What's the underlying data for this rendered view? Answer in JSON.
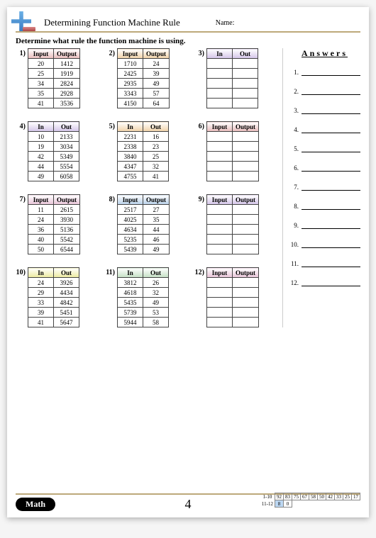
{
  "header": {
    "title": "Determining Function Machine Rule",
    "name_label": "Name:"
  },
  "instruction": "Determine what rule the function machine is using.",
  "answers_heading": "Answers",
  "answer_count": 12,
  "footer": {
    "math_label": "Math",
    "page_number": "4",
    "score_rows": [
      {
        "lbl": "1-10",
        "cells": [
          "92",
          "83",
          "75",
          "67",
          "58",
          "50",
          "42",
          "33",
          "25",
          "17"
        ]
      },
      {
        "lbl": "11-12",
        "cells": [
          "8",
          "0"
        ]
      }
    ]
  },
  "problems": [
    {
      "n": "1)",
      "head": [
        "Input",
        "Output"
      ],
      "grad": "g-red",
      "rows": [
        [
          "20",
          "1412"
        ],
        [
          "25",
          "1919"
        ],
        [
          "34",
          "2824"
        ],
        [
          "35",
          "2928"
        ],
        [
          "41",
          "3536"
        ]
      ]
    },
    {
      "n": "2)",
      "head": [
        "Input",
        "Output"
      ],
      "grad": "g-orange",
      "rows": [
        [
          "1710",
          "24"
        ],
        [
          "2425",
          "39"
        ],
        [
          "2935",
          "49"
        ],
        [
          "3343",
          "57"
        ],
        [
          "4150",
          "64"
        ]
      ]
    },
    {
      "n": "3)",
      "head": [
        "In",
        "Out"
      ],
      "grad": "g-purple",
      "rows": [
        [
          "",
          ""
        ],
        [
          "",
          ""
        ],
        [
          "",
          ""
        ],
        [
          "",
          ""
        ],
        [
          "",
          ""
        ]
      ]
    },
    {
      "n": "4)",
      "head": [
        "In",
        "Out"
      ],
      "grad": "g-purple",
      "rows": [
        [
          "10",
          "2133"
        ],
        [
          "19",
          "3034"
        ],
        [
          "42",
          "5349"
        ],
        [
          "44",
          "5554"
        ],
        [
          "49",
          "6058"
        ]
      ]
    },
    {
      "n": "5)",
      "head": [
        "In",
        "Out"
      ],
      "grad": "g-orange",
      "rows": [
        [
          "2231",
          "16"
        ],
        [
          "2338",
          "23"
        ],
        [
          "3840",
          "25"
        ],
        [
          "4347",
          "32"
        ],
        [
          "4755",
          "41"
        ]
      ]
    },
    {
      "n": "6)",
      "head": [
        "Input",
        "Output"
      ],
      "grad": "g-red",
      "rows": [
        [
          "",
          ""
        ],
        [
          "",
          ""
        ],
        [
          "",
          ""
        ],
        [
          "",
          ""
        ],
        [
          "",
          ""
        ]
      ]
    },
    {
      "n": "7)",
      "head": [
        "Input",
        "Output"
      ],
      "grad": "g-pink",
      "rows": [
        [
          "11",
          "2615"
        ],
        [
          "24",
          "3930"
        ],
        [
          "36",
          "5136"
        ],
        [
          "40",
          "5542"
        ],
        [
          "50",
          "6544"
        ]
      ]
    },
    {
      "n": "8)",
      "head": [
        "Input",
        "Output"
      ],
      "grad": "g-blue",
      "rows": [
        [
          "2517",
          "27"
        ],
        [
          "4025",
          "35"
        ],
        [
          "4634",
          "44"
        ],
        [
          "5235",
          "46"
        ],
        [
          "5439",
          "49"
        ]
      ]
    },
    {
      "n": "9)",
      "head": [
        "Input",
        "Output"
      ],
      "grad": "g-purple",
      "rows": [
        [
          "",
          ""
        ],
        [
          "",
          ""
        ],
        [
          "",
          ""
        ],
        [
          "",
          ""
        ],
        [
          "",
          ""
        ]
      ]
    },
    {
      "n": "10)",
      "head": [
        "In",
        "Out"
      ],
      "grad": "g-yellow",
      "rows": [
        [
          "24",
          "3926"
        ],
        [
          "29",
          "4434"
        ],
        [
          "33",
          "4842"
        ],
        [
          "39",
          "5451"
        ],
        [
          "41",
          "5647"
        ]
      ]
    },
    {
      "n": "11)",
      "head": [
        "In",
        "Out"
      ],
      "grad": "g-green",
      "rows": [
        [
          "3812",
          "26"
        ],
        [
          "4618",
          "32"
        ],
        [
          "5435",
          "49"
        ],
        [
          "5739",
          "53"
        ],
        [
          "5944",
          "58"
        ]
      ]
    },
    {
      "n": "12)",
      "head": [
        "Input",
        "Output"
      ],
      "grad": "g-pink",
      "rows": [
        [
          "",
          ""
        ],
        [
          "",
          ""
        ],
        [
          "",
          ""
        ],
        [
          "",
          ""
        ],
        [
          "",
          ""
        ]
      ]
    }
  ]
}
